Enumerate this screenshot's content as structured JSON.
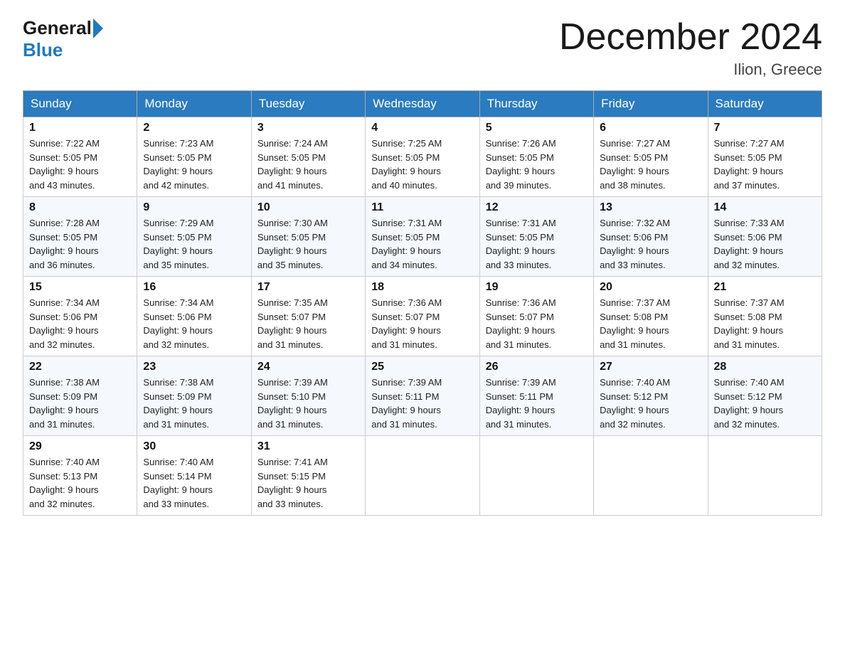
{
  "logo": {
    "general": "General",
    "blue": "Blue"
  },
  "title": "December 2024",
  "location": "Ilion, Greece",
  "days_of_week": [
    "Sunday",
    "Monday",
    "Tuesday",
    "Wednesday",
    "Thursday",
    "Friday",
    "Saturday"
  ],
  "weeks": [
    [
      {
        "day": "1",
        "sunrise": "7:22 AM",
        "sunset": "5:05 PM",
        "daylight": "9 hours and 43 minutes."
      },
      {
        "day": "2",
        "sunrise": "7:23 AM",
        "sunset": "5:05 PM",
        "daylight": "9 hours and 42 minutes."
      },
      {
        "day": "3",
        "sunrise": "7:24 AM",
        "sunset": "5:05 PM",
        "daylight": "9 hours and 41 minutes."
      },
      {
        "day": "4",
        "sunrise": "7:25 AM",
        "sunset": "5:05 PM",
        "daylight": "9 hours and 40 minutes."
      },
      {
        "day": "5",
        "sunrise": "7:26 AM",
        "sunset": "5:05 PM",
        "daylight": "9 hours and 39 minutes."
      },
      {
        "day": "6",
        "sunrise": "7:27 AM",
        "sunset": "5:05 PM",
        "daylight": "9 hours and 38 minutes."
      },
      {
        "day": "7",
        "sunrise": "7:27 AM",
        "sunset": "5:05 PM",
        "daylight": "9 hours and 37 minutes."
      }
    ],
    [
      {
        "day": "8",
        "sunrise": "7:28 AM",
        "sunset": "5:05 PM",
        "daylight": "9 hours and 36 minutes."
      },
      {
        "day": "9",
        "sunrise": "7:29 AM",
        "sunset": "5:05 PM",
        "daylight": "9 hours and 35 minutes."
      },
      {
        "day": "10",
        "sunrise": "7:30 AM",
        "sunset": "5:05 PM",
        "daylight": "9 hours and 35 minutes."
      },
      {
        "day": "11",
        "sunrise": "7:31 AM",
        "sunset": "5:05 PM",
        "daylight": "9 hours and 34 minutes."
      },
      {
        "day": "12",
        "sunrise": "7:31 AM",
        "sunset": "5:05 PM",
        "daylight": "9 hours and 33 minutes."
      },
      {
        "day": "13",
        "sunrise": "7:32 AM",
        "sunset": "5:06 PM",
        "daylight": "9 hours and 33 minutes."
      },
      {
        "day": "14",
        "sunrise": "7:33 AM",
        "sunset": "5:06 PM",
        "daylight": "9 hours and 32 minutes."
      }
    ],
    [
      {
        "day": "15",
        "sunrise": "7:34 AM",
        "sunset": "5:06 PM",
        "daylight": "9 hours and 32 minutes."
      },
      {
        "day": "16",
        "sunrise": "7:34 AM",
        "sunset": "5:06 PM",
        "daylight": "9 hours and 32 minutes."
      },
      {
        "day": "17",
        "sunrise": "7:35 AM",
        "sunset": "5:07 PM",
        "daylight": "9 hours and 31 minutes."
      },
      {
        "day": "18",
        "sunrise": "7:36 AM",
        "sunset": "5:07 PM",
        "daylight": "9 hours and 31 minutes."
      },
      {
        "day": "19",
        "sunrise": "7:36 AM",
        "sunset": "5:07 PM",
        "daylight": "9 hours and 31 minutes."
      },
      {
        "day": "20",
        "sunrise": "7:37 AM",
        "sunset": "5:08 PM",
        "daylight": "9 hours and 31 minutes."
      },
      {
        "day": "21",
        "sunrise": "7:37 AM",
        "sunset": "5:08 PM",
        "daylight": "9 hours and 31 minutes."
      }
    ],
    [
      {
        "day": "22",
        "sunrise": "7:38 AM",
        "sunset": "5:09 PM",
        "daylight": "9 hours and 31 minutes."
      },
      {
        "day": "23",
        "sunrise": "7:38 AM",
        "sunset": "5:09 PM",
        "daylight": "9 hours and 31 minutes."
      },
      {
        "day": "24",
        "sunrise": "7:39 AM",
        "sunset": "5:10 PM",
        "daylight": "9 hours and 31 minutes."
      },
      {
        "day": "25",
        "sunrise": "7:39 AM",
        "sunset": "5:11 PM",
        "daylight": "9 hours and 31 minutes."
      },
      {
        "day": "26",
        "sunrise": "7:39 AM",
        "sunset": "5:11 PM",
        "daylight": "9 hours and 31 minutes."
      },
      {
        "day": "27",
        "sunrise": "7:40 AM",
        "sunset": "5:12 PM",
        "daylight": "9 hours and 32 minutes."
      },
      {
        "day": "28",
        "sunrise": "7:40 AM",
        "sunset": "5:12 PM",
        "daylight": "9 hours and 32 minutes."
      }
    ],
    [
      {
        "day": "29",
        "sunrise": "7:40 AM",
        "sunset": "5:13 PM",
        "daylight": "9 hours and 32 minutes."
      },
      {
        "day": "30",
        "sunrise": "7:40 AM",
        "sunset": "5:14 PM",
        "daylight": "9 hours and 33 minutes."
      },
      {
        "day": "31",
        "sunrise": "7:41 AM",
        "sunset": "5:15 PM",
        "daylight": "9 hours and 33 minutes."
      },
      null,
      null,
      null,
      null
    ]
  ],
  "labels": {
    "sunrise": "Sunrise:",
    "sunset": "Sunset:",
    "daylight": "Daylight:"
  }
}
